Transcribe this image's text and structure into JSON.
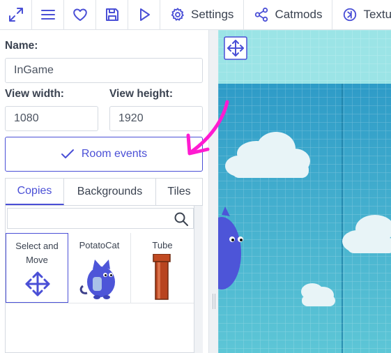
{
  "toolbar": {
    "icons": [
      "fullscreen-icon",
      "menu-icon",
      "heart-icon",
      "save-icon",
      "play-icon"
    ],
    "settings_label": "Settings",
    "catmods_label": "Catmods",
    "textures_label": "Textu"
  },
  "room": {
    "name_label": "Name:",
    "name_value": "InGame",
    "view_width_label": "View width:",
    "view_width_value": "1080",
    "view_height_label": "View height:",
    "view_height_value": "1920",
    "events_button_label": "Room events"
  },
  "tabs": [
    {
      "label": "Copies",
      "active": true
    },
    {
      "label": "Backgrounds",
      "active": false
    },
    {
      "label": "Tiles",
      "active": false
    }
  ],
  "copies": {
    "search_placeholder": "",
    "items": [
      {
        "label": "Select and Move",
        "icon": "move-arrows-icon",
        "selected": true
      },
      {
        "label": "PotatoCat",
        "icon": "blue-cat-sprite",
        "selected": false
      },
      {
        "label": "Tube",
        "icon": "red-pipe-sprite",
        "selected": false
      }
    ]
  },
  "colors": {
    "accent": "#4a4fd6",
    "sky_top": "#9be4e6",
    "sky_bottom": "#3aa3c8",
    "annotation_arrow": "#ff1bd1"
  }
}
